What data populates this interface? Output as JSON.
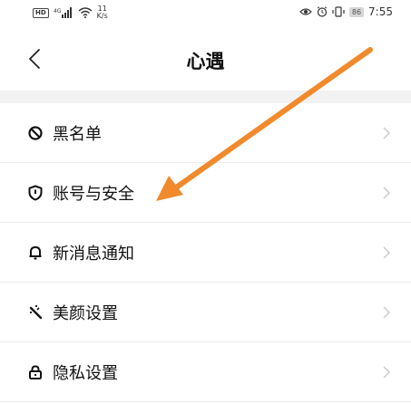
{
  "status_bar": {
    "hd_badge": "HD",
    "network": "4G",
    "speed_value": "11",
    "speed_unit": "K/s",
    "battery": "86",
    "time": "7:55"
  },
  "header": {
    "title": "心遇"
  },
  "menu": {
    "items": [
      {
        "label": "黑名单",
        "icon": "block-icon"
      },
      {
        "label": "账号与安全",
        "icon": "shield-icon"
      },
      {
        "label": "新消息通知",
        "icon": "bell-icon"
      },
      {
        "label": "美颜设置",
        "icon": "beauty-wand-icon"
      },
      {
        "label": "隐私设置",
        "icon": "lock-icon"
      }
    ]
  },
  "annotation": {
    "arrow_color": "#f08a2c"
  },
  "colors": {
    "background": "#ffffff",
    "separator_band": "#f2f2f2",
    "divider": "#ececec",
    "chevron": "#c8c8c8"
  }
}
